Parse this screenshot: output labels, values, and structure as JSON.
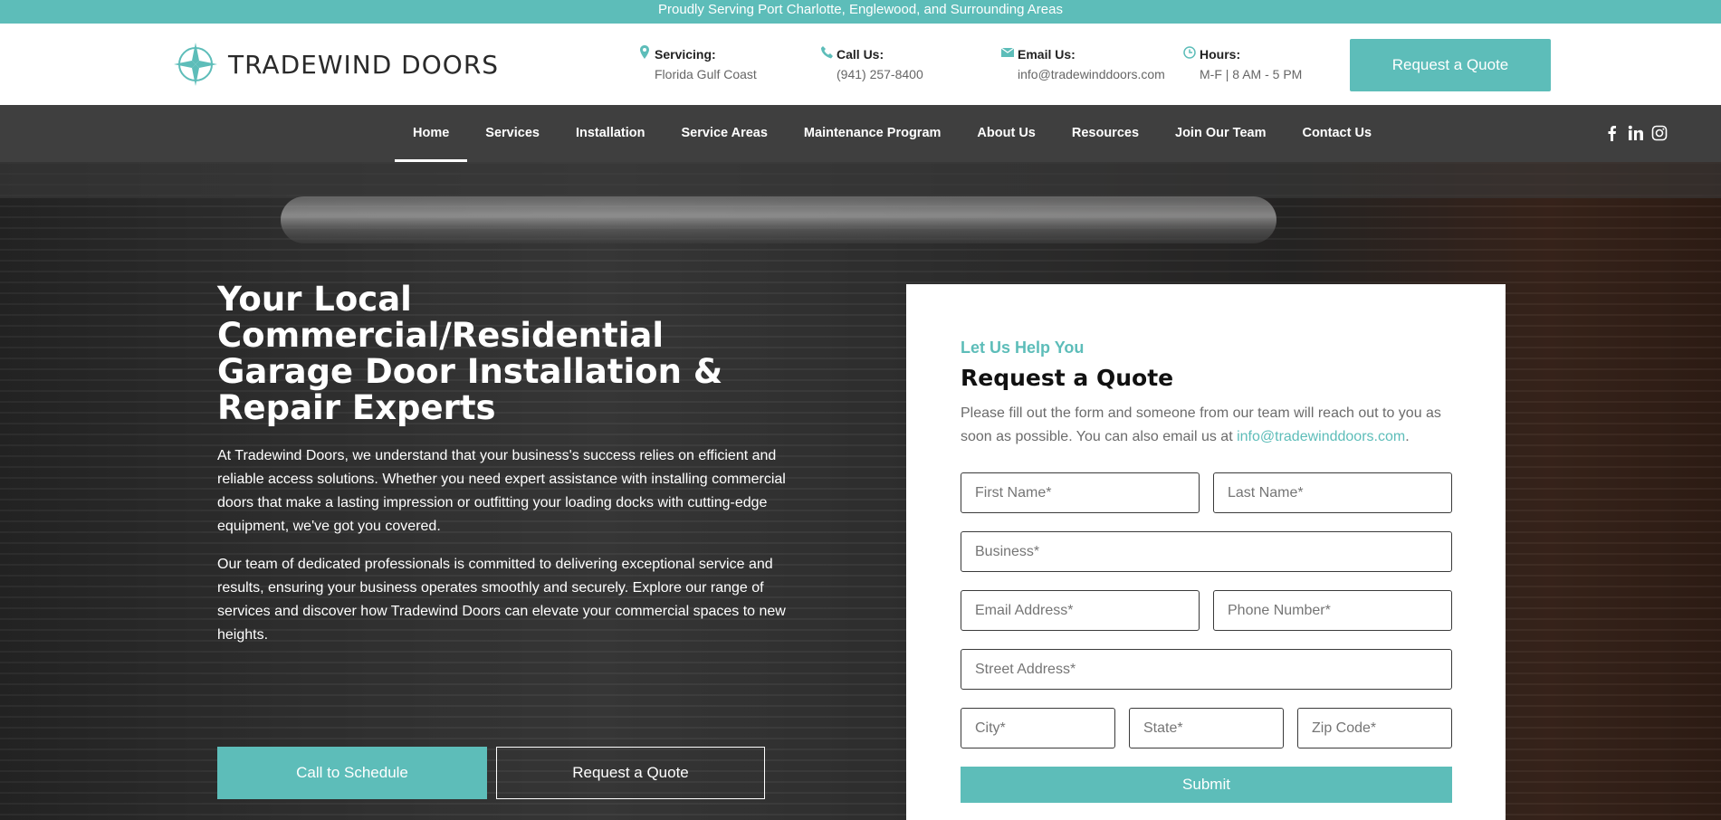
{
  "topbar": {
    "text": "Proudly Serving Port Charlotte, Englewood, and Surrounding Areas"
  },
  "header": {
    "logo_text": "TRADEWIND DOORS",
    "info": [
      {
        "label": "Servicing:",
        "value": "Florida Gulf Coast",
        "icon": "map-pin-icon"
      },
      {
        "label": "Call Us:",
        "value": "(941) 257-8400",
        "icon": "phone-icon"
      },
      {
        "label": "Email Us:",
        "value": "info@tradewinddoors.com",
        "icon": "envelope-icon"
      },
      {
        "label": "Hours:",
        "value": "M-F | 8 AM - 5 PM",
        "icon": "clock-icon"
      }
    ],
    "cta": "Request a Quote"
  },
  "nav": {
    "items": [
      "Home",
      "Services",
      "Installation",
      "Service Areas",
      "Maintenance Program",
      "About Us",
      "Resources",
      "Join Our Team",
      "Contact Us"
    ],
    "active": "Home",
    "social": [
      "facebook-icon",
      "linkedin-icon",
      "instagram-icon"
    ]
  },
  "hero": {
    "title": "Your Local Commercial/Residential Garage Door Installation & Repair Experts",
    "p1": "At Tradewind Doors, we understand that your business's success relies on efficient and reliable access solutions. Whether you need expert assistance with installing commercial doors that make a lasting impression or outfitting your loading docks with cutting-edge equipment, we've got you covered.",
    "p2": "Our team of dedicated professionals is committed to delivering exceptional service and results, ensuring your business operates smoothly and securely. Explore our range of services and discover how Tradewind Doors can elevate your commercial spaces to new heights.",
    "btn_call": "Call to Schedule",
    "btn_quote": "Request a Quote"
  },
  "form": {
    "eyebrow": "Let Us Help You",
    "title": "Request a Quote",
    "desc_prefix": "Please fill out the form and someone from our team will reach out to you as soon as possible. You can also email us at ",
    "desc_email": "info@tradewinddoors.com",
    "desc_suffix": ".",
    "placeholders": {
      "first_name": "First Name*",
      "last_name": "Last Name*",
      "business": "Business*",
      "email": "Email Address*",
      "phone": "Phone Number*",
      "street": "Street Address*",
      "city": "City*",
      "state": "State*",
      "zip": "Zip Code*"
    },
    "submit": "Submit"
  },
  "colors": {
    "accent": "#5dbdb9",
    "nav_bg": "#3f3f3f"
  }
}
